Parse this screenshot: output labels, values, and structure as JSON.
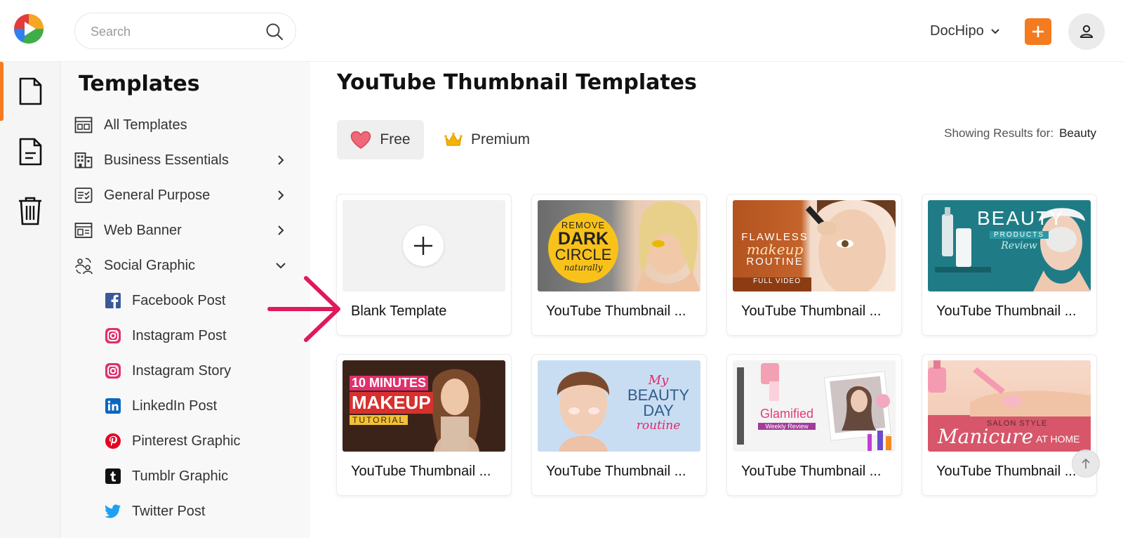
{
  "header": {
    "search_placeholder": "Search",
    "brand_label": "DocHipo"
  },
  "colors": {
    "accent": "#f47b20",
    "arrow": "#e0195a"
  },
  "sidebar": {
    "title": "Templates",
    "items": [
      {
        "label": "All Templates",
        "icon": "layout-icon"
      },
      {
        "label": "Business Essentials",
        "icon": "building-icon"
      },
      {
        "label": "General Purpose",
        "icon": "checklist-icon"
      },
      {
        "label": "Web Banner",
        "icon": "banner-icon"
      },
      {
        "label": "Social Graphic",
        "icon": "social-icon"
      }
    ],
    "sub_items": [
      {
        "label": "Facebook Post",
        "icon": "facebook-icon"
      },
      {
        "label": "Instagram Post",
        "icon": "instagram-icon"
      },
      {
        "label": "Instagram Story",
        "icon": "instagram-icon"
      },
      {
        "label": "LinkedIn Post",
        "icon": "linkedin-icon"
      },
      {
        "label": "Pinterest Graphic",
        "icon": "pinterest-icon"
      },
      {
        "label": "Tumblr Graphic",
        "icon": "tumblr-icon"
      },
      {
        "label": "Twitter Post",
        "icon": "twitter-icon"
      }
    ]
  },
  "main": {
    "title": "YouTube Thumbnail Templates",
    "filters": {
      "free": "Free",
      "premium": "Premium"
    },
    "results_prefix": "Showing Results for:",
    "results_value": "Beauty",
    "cards": [
      {
        "label": "Blank Template"
      },
      {
        "label": "YouTube Thumbnail ...",
        "text1": "REMOVE",
        "text2": "DARK",
        "text3": "CIRCLE",
        "text4": "naturally"
      },
      {
        "label": "YouTube Thumbnail ...",
        "text1": "FLAWLESS",
        "text2": "makeup",
        "text3": "ROUTINE",
        "text4": "FULL VIDEO"
      },
      {
        "label": "YouTube Thumbnail ...",
        "text1": "BEAUTY",
        "text2": "PRODUCTS",
        "text3": "Review"
      },
      {
        "label": "YouTube Thumbnail ...",
        "text1": "10 MINUTES",
        "text2": "MAKEUP",
        "text3": "TUTORIAL"
      },
      {
        "label": "YouTube Thumbnail ...",
        "text1": "My",
        "text2": "BEAUTY",
        "text3": "DAY",
        "text4": "routine"
      },
      {
        "label": "YouTube Thumbnail ...",
        "text1": "Glamified",
        "text2": "Weekly Review"
      },
      {
        "label": "YouTube Thumbnail ...",
        "text1": "SALON STYLE",
        "text2": "Manicure",
        "text3": "AT HOME"
      }
    ]
  }
}
